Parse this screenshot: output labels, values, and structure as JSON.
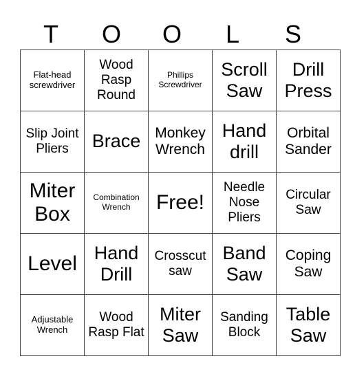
{
  "header": [
    "T",
    "O",
    "O",
    "L",
    "S"
  ],
  "grid": [
    [
      "Flat-head screwdriver",
      "Wood Rasp Round",
      "Phillips Screwdriver",
      "Scroll Saw",
      "Drill Press"
    ],
    [
      "Slip Joint Pliers",
      "Brace",
      "Monkey Wrench",
      "Hand drill",
      "Orbital Sander"
    ],
    [
      "Miter Box",
      "Combination Wrench",
      "Free!",
      "Needle Nose Pliers",
      "Circular Saw"
    ],
    [
      "Level",
      "Hand Drill",
      "Crosscut saw",
      "Band Saw",
      "Coping Saw"
    ],
    [
      "Adjustable Wrench",
      "Wood Rasp Flat",
      "Miter Saw",
      "Sanding Block",
      "Table Saw"
    ]
  ]
}
